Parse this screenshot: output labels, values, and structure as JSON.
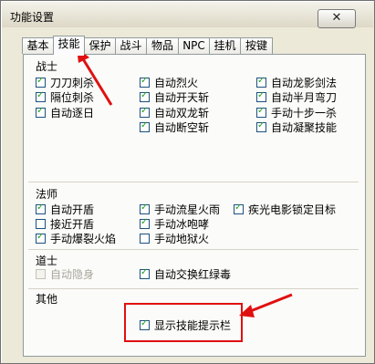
{
  "window": {
    "title": "功能设置",
    "close_label": "✕"
  },
  "tabs": [
    {
      "label": "基本",
      "active": false
    },
    {
      "label": "技能",
      "active": true
    },
    {
      "label": "保护",
      "active": false
    },
    {
      "label": "战斗",
      "active": false
    },
    {
      "label": "物品",
      "active": false
    },
    {
      "label": "NPC",
      "active": false
    },
    {
      "label": "挂机",
      "active": false
    },
    {
      "label": "按键",
      "active": false
    }
  ],
  "groups": {
    "warrior": {
      "title": "战士",
      "items": [
        {
          "label": "刀刀刺杀",
          "checked": true
        },
        {
          "label": "隔位刺杀",
          "checked": true
        },
        {
          "label": "自动逐日",
          "checked": true
        },
        {
          "label": "自动烈火",
          "checked": true
        },
        {
          "label": "自动开天斩",
          "checked": true
        },
        {
          "label": "自动双龙斩",
          "checked": true
        },
        {
          "label": "自动断空斩",
          "checked": true
        },
        {
          "label": "自动龙影剑法",
          "checked": true
        },
        {
          "label": "自动半月弯刀",
          "checked": true
        },
        {
          "label": "手动十步一杀",
          "checked": true
        },
        {
          "label": "自动凝聚技能",
          "checked": true
        }
      ]
    },
    "mage": {
      "title": "法师",
      "items": [
        {
          "label": "自动开盾",
          "checked": true
        },
        {
          "label": "接近开盾",
          "checked": false
        },
        {
          "label": "手动爆裂火焰",
          "checked": true
        },
        {
          "label": "手动流星火雨",
          "checked": true
        },
        {
          "label": "手动冰咆哮",
          "checked": true
        },
        {
          "label": "手动地狱火",
          "checked": false
        },
        {
          "label": "疾光电影锁定目标",
          "checked": true
        }
      ]
    },
    "taoist": {
      "title": "道士",
      "items": [
        {
          "label": "自动隐身",
          "checked": false,
          "disabled": true
        },
        {
          "label": "自动交换红绿毒",
          "checked": true
        }
      ]
    },
    "other": {
      "title": "其他",
      "items": [
        {
          "label": "显示技能提示栏",
          "checked": true
        }
      ]
    }
  },
  "colors": {
    "annotation_red": "#e01010",
    "check_green": "#21a121",
    "window_bg": "#ece9d8"
  }
}
